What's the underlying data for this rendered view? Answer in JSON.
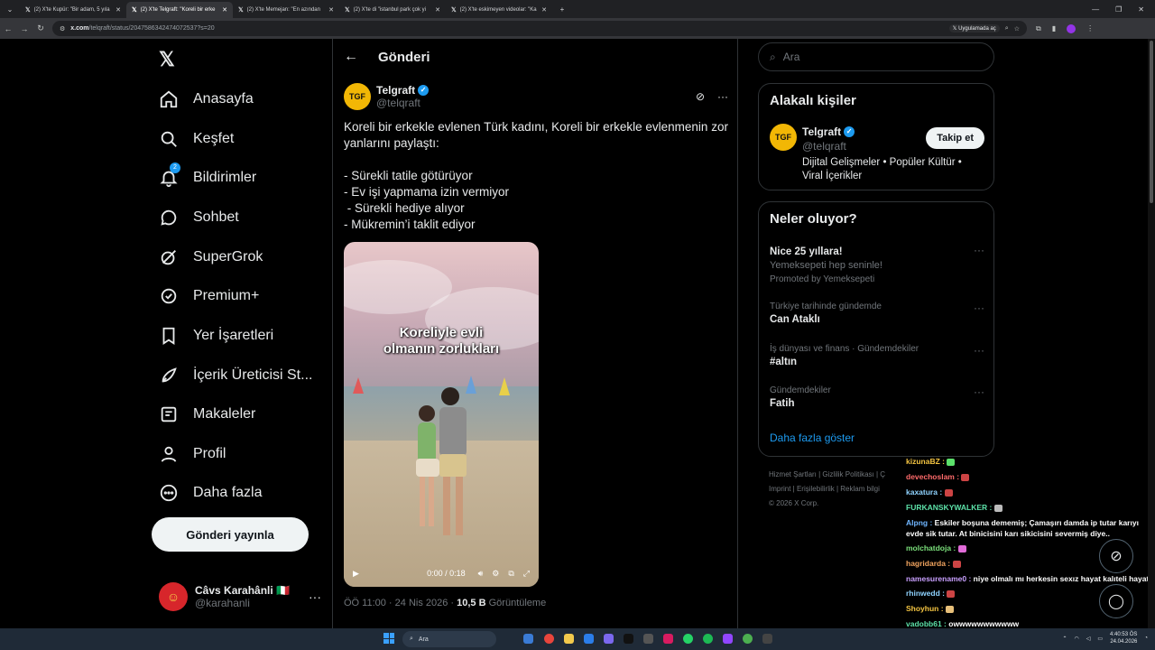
{
  "browser": {
    "tabs": [
      {
        "label": "(2) X'te Kupür: \"Bir adam, 5 yıla",
        "active": false
      },
      {
        "label": "(2) X'te Telgraft: \"Koreli bir erke",
        "active": true
      },
      {
        "label": "(2) X'te Memejan: \"En azından",
        "active": false
      },
      {
        "label": "(2) X'te di \"istanbul park çok yi",
        "active": false
      },
      {
        "label": "(2) X'te eskimeyen videolar: \"Ka",
        "active": false
      }
    ],
    "url_host": "x.com",
    "url_path": "/telqraft/status/2047586342474072537?s=20",
    "app_button": "Uygulamada aç"
  },
  "nav": {
    "items": [
      {
        "label": "Anasayfa",
        "icon": "home-icon"
      },
      {
        "label": "Keşfet",
        "icon": "search-icon"
      },
      {
        "label": "Bildirimler",
        "icon": "bell-icon",
        "badge": "2"
      },
      {
        "label": "Sohbet",
        "icon": "chat-icon"
      },
      {
        "label": "SuperGrok",
        "icon": "grok-icon"
      },
      {
        "label": "Premium+",
        "icon": "verified-icon"
      },
      {
        "label": "Yer İşaretleri",
        "icon": "bookmark-icon"
      },
      {
        "label": "İçerik Üreticisi St...",
        "icon": "rocket-icon"
      },
      {
        "label": "Makaleler",
        "icon": "article-icon"
      },
      {
        "label": "Profil",
        "icon": "person-icon"
      },
      {
        "label": "Daha fazla",
        "icon": "more-circle-icon"
      }
    ],
    "post_button": "Gönderi yayınla",
    "user": {
      "name": "Câvs Karahânli 🇮🇹",
      "handle": "@karahanli"
    }
  },
  "main": {
    "header_title": "Gönderi",
    "post": {
      "author": "Telgraft",
      "handle": "@telqraft",
      "avatar_text": "TGF",
      "text": "Koreli bir erkekle evlenen Türk kadını, Koreli bir erkekle evlenmenin zor yanlarını paylaştı:\n\n- Sürekli tatile götürüyor\n- Ev işi yapmama izin vermiyor\n - Sürekli hediye alıyor\n- Mükremin’i taklit ediyor",
      "video_caption_1": "Koreliyle evli",
      "video_caption_2": "olmanın zorlukları",
      "video_time": "0:00 / 0:18",
      "meta_time": "ÖÖ 11:00 · 24 Nis 2026 · ",
      "views": "10,5 B",
      "views_label": " Görüntüleme"
    }
  },
  "right": {
    "search_placeholder": "Ara",
    "related": {
      "title": "Alakalı kişiler",
      "name": "Telgraft",
      "handle": "@telqraft",
      "bio": "Dijital Gelişmeler • Popüler Kültür • Viral İçerikler",
      "follow": "Takip et"
    },
    "trends": {
      "title": "Neler oluyor?",
      "items": [
        {
          "cat": "",
          "topic": "Nice 25 yıllara!",
          "sub": "Yemeksepeti hep seninle!",
          "promo": "Promoted by Yemeksepeti"
        },
        {
          "cat": "Türkiye tarihinde gündemde",
          "topic": "Can Ataklı"
        },
        {
          "cat": "İş dünyası ve finans · Gündemdekiler",
          "topic": "#altın"
        },
        {
          "cat": "Gündemdekiler",
          "topic": "Fatih"
        }
      ],
      "show_more": "Daha fazla göster"
    },
    "footer": {
      "line1": "Hizmet Şartları   |   Gizlilik Politikası   |   Ç",
      "line2": "Imprint   |   Erişilebilirlik   |   Reklam bilgi",
      "line3": "© 2026 X Corp."
    }
  },
  "chat": [
    {
      "user": "kizunaBZ :",
      "color": "#f5c542",
      "msg": ""
    },
    {
      "user": "devechoslam :",
      "color": "#ff6b6b",
      "msg": ""
    },
    {
      "user": "kaxatura :",
      "color": "#8fd3ff",
      "msg": ""
    },
    {
      "user": "FURKANSKYWALKER :",
      "color": "#5ce1a8",
      "msg": ""
    },
    {
      "user": "Alpng :",
      "color": "#6fb6ff",
      "msg": "Eskiler boşuna dememiş; Çamaşırı damda ip tutar karıyı evde sik tutar. At binicisini karı sikicisini severmiş diye.."
    },
    {
      "user": "molchatdoja :",
      "color": "#7be07b",
      "msg": ""
    },
    {
      "user": "hagridarda :",
      "color": "#f0a35e",
      "msg": ""
    },
    {
      "user": "namesurename0 :",
      "color": "#c9a0ff",
      "msg": "niye olmalı mı herkesin sexız hayat kalıteli hayat"
    },
    {
      "user": "rhinwedd :",
      "color": "#8fd3ff",
      "msg": ""
    },
    {
      "user": "Shoyhun :",
      "color": "#f5c542",
      "msg": ""
    },
    {
      "user": "vadobb61 :",
      "color": "#5ce1a8",
      "msg": "owwwwwwwwwww"
    }
  ],
  "taskbar": {
    "search": "Ara",
    "time": "4:40:53 ÖS",
    "date": "24.04.2026"
  },
  "colors": {
    "accent": "#1d9bf0",
    "bg": "#000000",
    "border": "#2f3336",
    "muted": "#71767b"
  }
}
